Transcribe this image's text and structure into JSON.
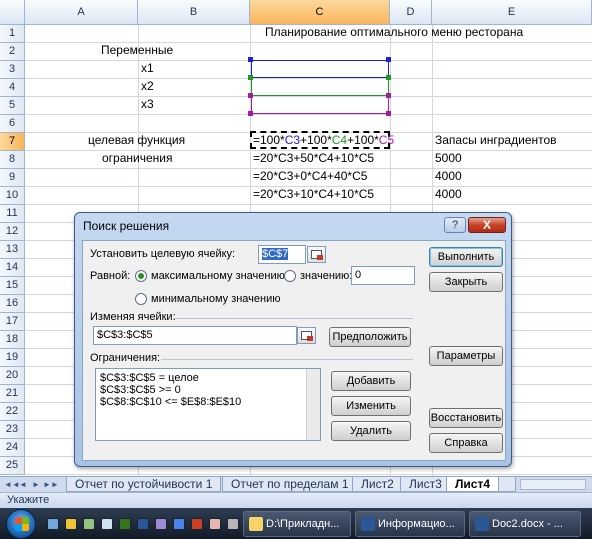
{
  "sheet": {
    "columns": [
      "A",
      "B",
      "C",
      "D",
      "E"
    ],
    "rows": [
      "1",
      "2",
      "3",
      "4",
      "5",
      "6",
      "7",
      "8",
      "9",
      "10",
      "11",
      "12",
      "13",
      "14",
      "15",
      "16",
      "17",
      "18",
      "19",
      "20",
      "21",
      "22",
      "23",
      "24",
      "25"
    ],
    "cells": {
      "c2": "Планирование  оптимального меню ресторана",
      "b2": "Переменные",
      "b3": "x1",
      "b4": "x2",
      "b5": "x3",
      "a7": "целевая функция",
      "c7_parts": [
        "=100*",
        "C3",
        "+100*",
        "C4",
        "+100*",
        "C5"
      ],
      "e7": "Запасы ингрaдиентов",
      "a8": "ограничения",
      "c8": "=20*C3+50*C4+10*C5",
      "e8": "5000",
      "c9": "=20*C3+0*C4+40*C5",
      "e9": "4000",
      "c10": "=20*C3+10*C4+10*C5",
      "e10": "4000"
    }
  },
  "tabs": {
    "nav": [
      "◄◄",
      "◄",
      "►",
      "►►"
    ],
    "items": [
      "Отчет по устойчивости 1",
      "Отчет по пределам 1",
      "Лист2",
      "Лист3",
      "Лист4"
    ],
    "active": "Лист4"
  },
  "status": {
    "text": "Укажите"
  },
  "taskbar": {
    "buttons": [
      "D:\\Прикладн...",
      "Информацио...",
      "Doc2.docx - ..."
    ]
  },
  "dialog": {
    "title": "Поиск решения",
    "help": "?",
    "close": "X",
    "target_label": "Установить целевую ячейку:",
    "target_value": "$C$7",
    "equal_label": "Равной:",
    "opt_max": "максимальному значению",
    "opt_value": "значению:",
    "value_field": "0",
    "opt_min": "минимальному значению",
    "changing_label": "Изменяя ячейки:",
    "changing_value": "$C$3:$C$5",
    "guess": "Предположить",
    "constraints_label": "Ограничения:",
    "constraints": [
      "$C$3:$C$5 = целое",
      "$C$3:$C$5 >= 0",
      "$C$8:$C$10 <= $E$8:$E$10"
    ],
    "add": "Добавить",
    "change": "Изменить",
    "delete": "Удалить",
    "solve": "Выполнить",
    "close_btn": "Закрыть",
    "options": "Параметры",
    "reset": "Восстановить",
    "help_btn": "Справка"
  }
}
